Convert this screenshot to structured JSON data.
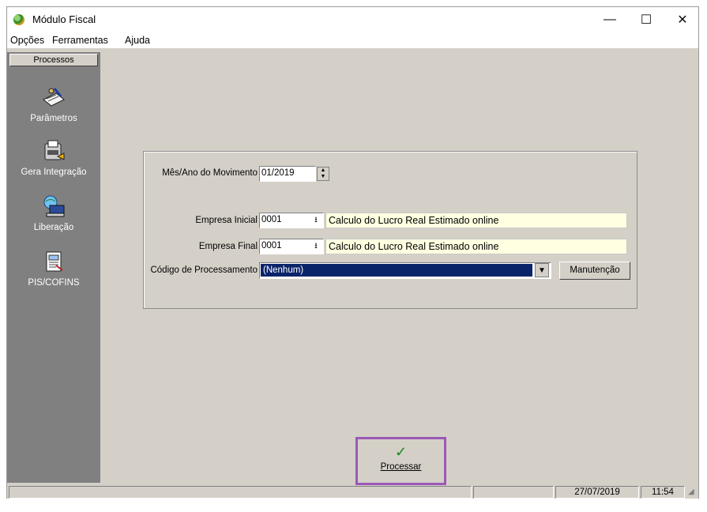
{
  "window": {
    "title": "Módulo Fiscal",
    "controls": {
      "minimize": "—",
      "maximize": "☐",
      "close": "✕"
    }
  },
  "menu": [
    {
      "label": "Opções"
    },
    {
      "label": "Ferramentas"
    },
    {
      "label": "Ajuda"
    }
  ],
  "sidebar": {
    "header": "Processos",
    "items": [
      {
        "label": "Parâmetros",
        "icon": "parameters-icon"
      },
      {
        "label": "Gera Integração",
        "icon": "integration-icon"
      },
      {
        "label": "Liberação",
        "icon": "release-icon"
      },
      {
        "label": "PIS/COFINS",
        "icon": "pis-cofins-icon"
      }
    ]
  },
  "form": {
    "mes_ano": {
      "label": "Mês/Ano do Movimento",
      "value": "01/2019"
    },
    "empresa_inicial": {
      "label": "Empresa Inicial",
      "value": "0001",
      "description": "Calculo do Lucro Real Estimado online"
    },
    "empresa_final": {
      "label": "Empresa Final",
      "value": "0001",
      "description": "Calculo do Lucro Real Estimado online"
    },
    "codigo": {
      "label": "Código de Processamento",
      "value": "(Nenhum)",
      "button": "Manutenção"
    }
  },
  "process_button": {
    "label": "Processar",
    "icon": "checkmark-icon"
  },
  "status": {
    "date": "27/07/2019",
    "time": "11:54"
  },
  "colors": {
    "sidebar": "#808080",
    "highlight": "#0a246a",
    "frame": "#9b59b6",
    "face": "#d4d0c8"
  }
}
